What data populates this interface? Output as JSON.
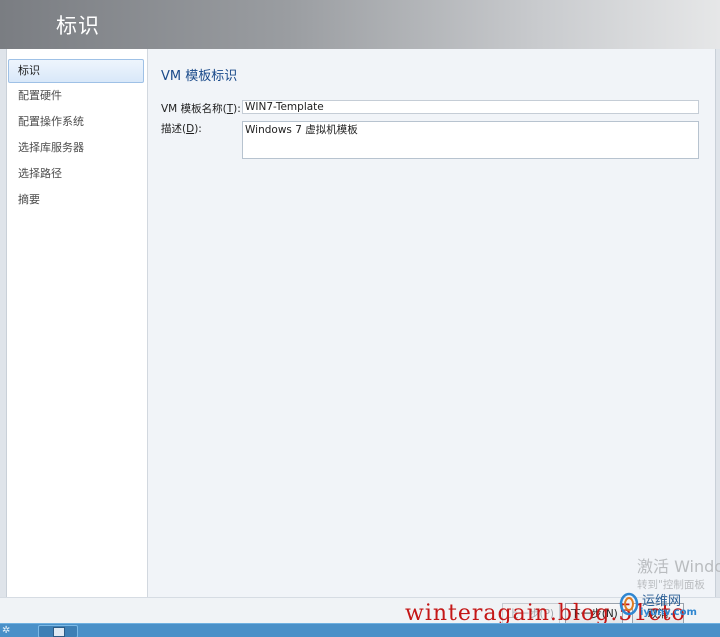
{
  "header": {
    "title": "标识"
  },
  "nav": {
    "items": [
      {
        "label": "标识",
        "active": true
      },
      {
        "label": "配置硬件",
        "active": false
      },
      {
        "label": "配置操作系统",
        "active": false
      },
      {
        "label": "选择库服务器",
        "active": false
      },
      {
        "label": "选择路径",
        "active": false
      },
      {
        "label": "摘要",
        "active": false
      }
    ]
  },
  "form": {
    "section_title": "VM 模板标识",
    "name_label_prefix": "VM 模板名称(",
    "name_label_key": "T",
    "name_label_suffix": "):",
    "name_value": "WIN7-Template",
    "desc_label_prefix": "描述(",
    "desc_label_key": "D",
    "desc_label_suffix": "):",
    "desc_value": "Windows 7 虚拟机模板"
  },
  "footer": {
    "prev_label": "上一步(P)",
    "next_label": "下一步(N)",
    "cancel_label": "取消"
  },
  "watermarks": {
    "activate_title": "激活 Windo",
    "activate_sub": "转到\"控制面板",
    "blog": "winteragain.blog.51cto",
    "site_name": "运维网",
    "site_url": "iyunv.com"
  },
  "colors": {
    "accent_title": "#1a4a8a",
    "nav_active_border": "#9fc1e6",
    "watermark_red": "#c41616",
    "taskbar": "#4a90c8"
  }
}
